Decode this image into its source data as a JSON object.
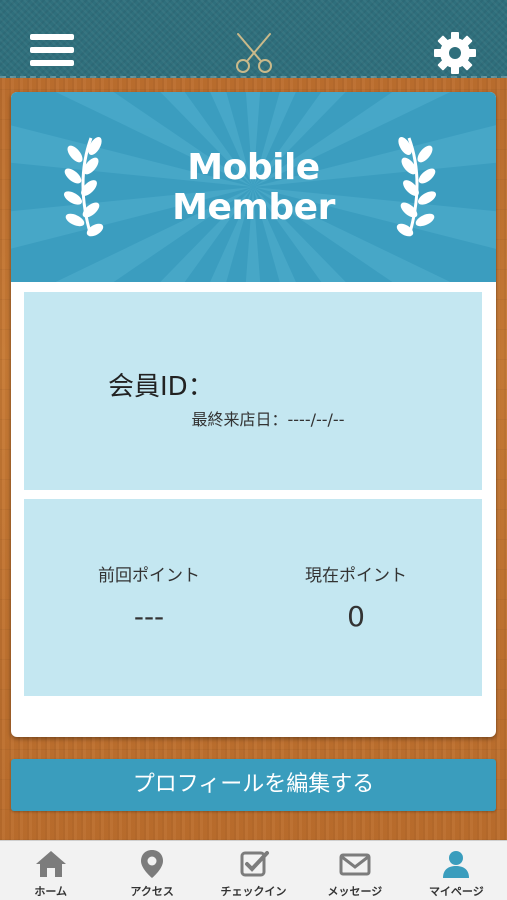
{
  "header": {
    "menu_icon": "hamburger-menu-icon",
    "logo_icon": "scissors-icon",
    "settings_icon": "gear-icon"
  },
  "card": {
    "title_line1": "Mobile",
    "title_line2": "Member",
    "member_id_label": "会員ID：",
    "last_visit_label": "最終来店日：----/--/--",
    "prev_points_label": "前回ポイント",
    "prev_points_value": "---",
    "current_points_label": "現在ポイント",
    "current_points_value": "0"
  },
  "edit_profile_button": "プロフィールを編集する",
  "tabs": [
    {
      "label": "ホーム",
      "icon": "home-icon"
    },
    {
      "label": "アクセス",
      "icon": "map-pin-icon"
    },
    {
      "label": "チェックイン",
      "icon": "checkbox-icon"
    },
    {
      "label": "メッセージ",
      "icon": "envelope-icon"
    },
    {
      "label": "マイページ",
      "icon": "person-icon",
      "active": true
    }
  ],
  "colors": {
    "header_bg": "#2f6f7c",
    "accent": "#3a9dbd",
    "panel": "#c4e7f1",
    "active_tab": "#3a9dbd"
  }
}
